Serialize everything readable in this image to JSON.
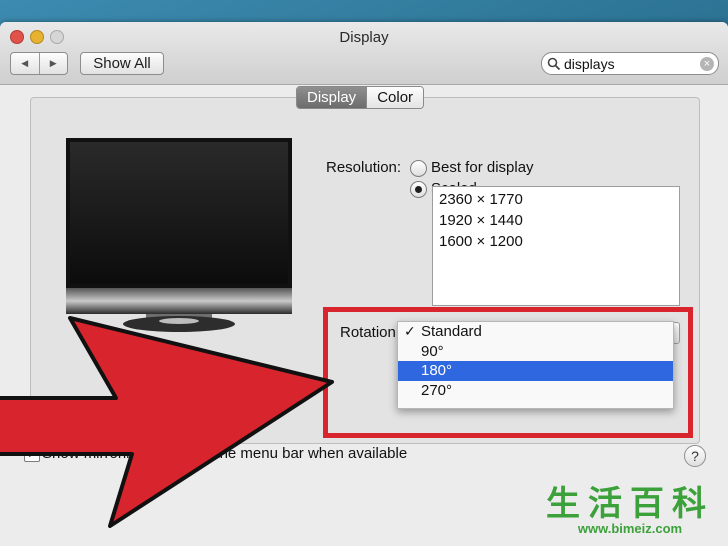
{
  "window": {
    "title": "Display",
    "show_all_label": "Show All",
    "nav_back_glyph": "◀",
    "nav_forward_glyph": "▶"
  },
  "search": {
    "value": "displays",
    "clear_glyph": "×"
  },
  "tabs": [
    {
      "label": "Display",
      "selected": true
    },
    {
      "label": "Color",
      "selected": false
    }
  ],
  "resolution": {
    "label": "Resolution:",
    "options": [
      {
        "label": "Best for display",
        "selected": false
      },
      {
        "label": "Scaled",
        "selected": true
      }
    ],
    "list": [
      "2360 × 1770",
      "1920 × 1440",
      "1600 × 1200"
    ]
  },
  "rotation": {
    "label": "Rotation",
    "items": [
      {
        "label": "Standard",
        "checked": true,
        "highlighted": false
      },
      {
        "label": "90°",
        "checked": false,
        "highlighted": false
      },
      {
        "label": "180°",
        "checked": false,
        "highlighted": true
      },
      {
        "label": "270°",
        "checked": false,
        "highlighted": false
      }
    ],
    "check_glyph": "✓"
  },
  "mirroring": {
    "label": "Show mirroring options in the menu bar when available",
    "checked": true,
    "check_glyph": "✓"
  },
  "help_glyph": "?",
  "watermark": {
    "glyphs": "生活百科",
    "url": "www.bimeiz.com"
  },
  "colors": {
    "highlight": "#2f67e0",
    "annotation_red": "#d8242d",
    "watermark_green": "#3ca13a"
  },
  "icons": [
    "search-icon",
    "clear-icon",
    "monitor-icon",
    "help-icon",
    "arrow-annotation"
  ]
}
